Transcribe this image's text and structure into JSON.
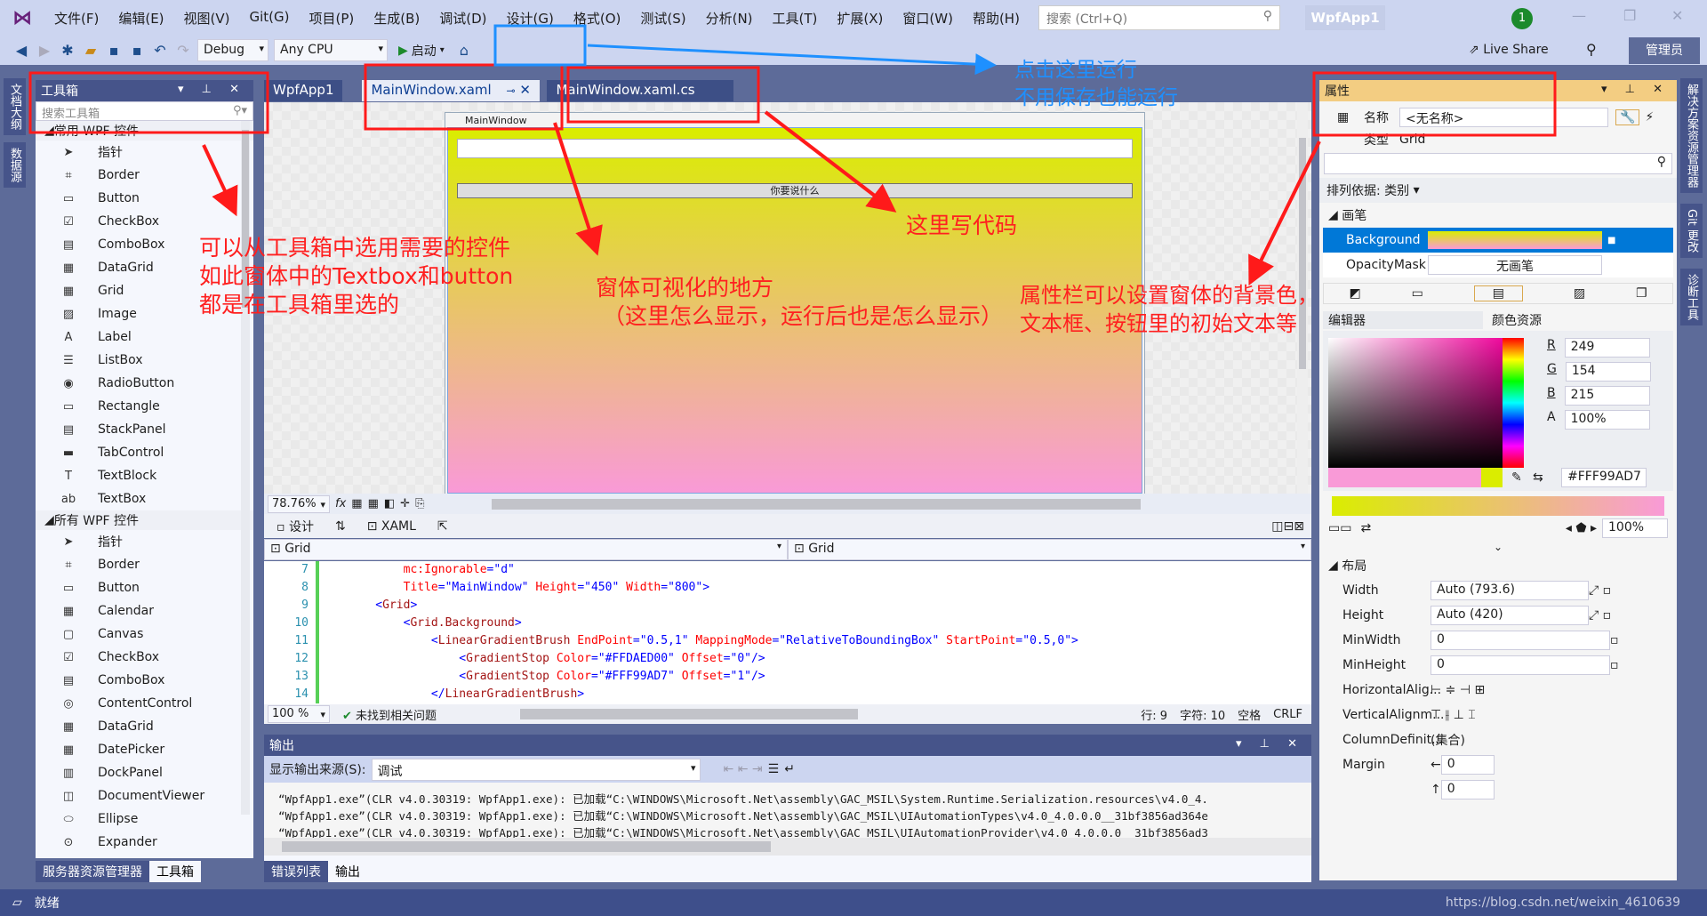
{
  "menu": [
    "文件(F)",
    "编辑(E)",
    "视图(V)",
    "Git(G)",
    "项目(P)",
    "生成(B)",
    "调试(D)",
    "设计(G)",
    "格式(O)",
    "测试(S)",
    "分析(N)",
    "工具(T)",
    "扩展(X)",
    "窗口(W)",
    "帮助(H)"
  ],
  "search_placeholder": "搜索 (Ctrl+Q)",
  "app_name": "WpfApp1",
  "notification_count": "1",
  "toolbar": {
    "config": "Debug",
    "platform": "Any CPU",
    "start": "启动",
    "live_share": "Live Share",
    "admin": "管理员"
  },
  "left_strip": [
    "文档大纲",
    "数据源"
  ],
  "right_strip": [
    "解决方案资源管理器",
    "Git 更改",
    "诊断工具"
  ],
  "toolbox": {
    "title": "工具箱",
    "search_placeholder": "搜索工具箱",
    "groups": [
      {
        "label": "常用 WPF 控件",
        "items": [
          "指针",
          "Border",
          "Button",
          "CheckBox",
          "ComboBox",
          "DataGrid",
          "Grid",
          "Image",
          "Label",
          "ListBox",
          "RadioButton",
          "Rectangle",
          "StackPanel",
          "TabControl",
          "TextBlock",
          "TextBox"
        ]
      },
      {
        "label": "所有 WPF 控件",
        "items": [
          "指针",
          "Border",
          "Button",
          "Calendar",
          "Canvas",
          "CheckBox",
          "ComboBox",
          "ContentControl",
          "DataGrid",
          "DatePicker",
          "DockPanel",
          "DocumentViewer",
          "Ellipse",
          "Expander"
        ]
      }
    ],
    "bottom_tabs": [
      "服务器资源管理器",
      "工具箱"
    ]
  },
  "doc_tabs": [
    "WpfApp1",
    "MainWindow.xaml",
    "MainWindow.xaml.cs"
  ],
  "designer": {
    "window_title": "MainWindow",
    "button_text": "你要说什么",
    "zoom": "78.76%",
    "gradient": [
      "#DAED00",
      "#F99AD7"
    ]
  },
  "view_tabs": {
    "design": "设计",
    "xaml": "XAML"
  },
  "code_combos": [
    "Grid",
    "Grid"
  ],
  "code": [
    {
      "n": "7",
      "t": [
        [
          "        ",
          ""
        ],
        [
          "mc:Ignorable",
          "a"
        ],
        [
          "=\"d\"",
          "v"
        ]
      ]
    },
    {
      "n": "8",
      "t": [
        [
          "        ",
          ""
        ],
        [
          "Title",
          "a"
        ],
        [
          "=\"MainWindow\" ",
          "v"
        ],
        [
          "Height",
          "a"
        ],
        [
          "=\"450\" ",
          "v"
        ],
        [
          "Width",
          "a"
        ],
        [
          "=\"800\">",
          "v"
        ]
      ]
    },
    {
      "n": "9",
      "t": [
        [
          "    <",
          "p"
        ],
        [
          "Grid",
          "k"
        ],
        [
          ">",
          "p"
        ]
      ]
    },
    {
      "n": "10",
      "t": [
        [
          "        <",
          "p"
        ],
        [
          "Grid.Background",
          "k"
        ],
        [
          ">",
          "p"
        ]
      ]
    },
    {
      "n": "11",
      "t": [
        [
          "            <",
          "p"
        ],
        [
          "LinearGradientBrush ",
          "k"
        ],
        [
          "EndPoint",
          "a"
        ],
        [
          "=\"0.5,1\" ",
          "v"
        ],
        [
          "MappingMode",
          "a"
        ],
        [
          "=\"RelativeToBoundingBox\" ",
          "v"
        ],
        [
          "StartPoint",
          "a"
        ],
        [
          "=\"0.5,0\">",
          "v"
        ]
      ]
    },
    {
      "n": "12",
      "t": [
        [
          "                <",
          "p"
        ],
        [
          "GradientStop ",
          "k"
        ],
        [
          "Color",
          "a"
        ],
        [
          "=\"#FFDAED00\" ",
          "v"
        ],
        [
          "Offset",
          "a"
        ],
        [
          "=\"0\"/>",
          "v"
        ]
      ]
    },
    {
      "n": "13",
      "t": [
        [
          "                <",
          "p"
        ],
        [
          "GradientStop ",
          "k"
        ],
        [
          "Color",
          "a"
        ],
        [
          "=\"#FFF99AD7\" ",
          "v"
        ],
        [
          "Offset",
          "a"
        ],
        [
          "=\"1\"/>",
          "v"
        ]
      ]
    },
    {
      "n": "14",
      "t": [
        [
          "            </",
          "p"
        ],
        [
          "LinearGradientBrush",
          "k"
        ],
        [
          ">",
          "p"
        ]
      ]
    }
  ],
  "code_status": {
    "zoom": "100 %",
    "issues": "未找到相关问题",
    "line": "行: 9",
    "char": "字符: 10",
    "spaces": "空格",
    "eol": "CRLF"
  },
  "output": {
    "title": "输出",
    "source_label": "显示输出来源(S):",
    "source": "调试",
    "lines": [
      "“WpfApp1.exe”(CLR v4.0.30319: WpfApp1.exe): 已加载“C:\\WINDOWS\\Microsoft.Net\\assembly\\GAC_MSIL\\System.Runtime.Serialization.resources\\v4.0_4.",
      "“WpfApp1.exe”(CLR v4.0.30319: WpfApp1.exe): 已加载“C:\\WINDOWS\\Microsoft.Net\\assembly\\GAC_MSIL\\UIAutomationTypes\\v4.0_4.0.0.0__31bf3856ad364e",
      "“WpfApp1.exe”(CLR v4.0.30319: WpfApp1.exe): 已加载“C:\\WINDOWS\\Microsoft.Net\\assembly\\GAC_MSIL\\UIAutomationProvider\\v4.0_4.0.0.0__31bf3856ad3"
    ],
    "tabs": [
      "错误列表",
      "输出"
    ]
  },
  "properties": {
    "title": "属性",
    "name_label": "名称",
    "name_value": "<无名称>",
    "type_label": "类型",
    "type_value": "Grid",
    "sort": "排列依据: 类别",
    "brush_group": "画笔",
    "background": "Background",
    "opacity_mask": "OpacityMask",
    "no_brush": "无画笔",
    "editor_tab": "编辑器",
    "resources_tab": "颜色资源",
    "r": "249",
    "g": "154",
    "b": "215",
    "a": "100%",
    "hex": "#FFF99AD7",
    "stop_opacity": "100%",
    "layout_group": "布局",
    "layout": [
      [
        "Width",
        "Auto (793.6)"
      ],
      [
        "Height",
        "Auto (420)"
      ],
      [
        "MinWidth",
        "0"
      ],
      [
        "MinHeight",
        "0"
      ]
    ],
    "halign": "HorizontalAlig...",
    "valign": "VerticalAlignm...",
    "coldef": "ColumnDefinit...",
    "coldef_value": "(集合)",
    "margin": "Margin",
    "margin_values": [
      "0",
      "0"
    ]
  },
  "status": "就绪",
  "watermark": "https://blog.csdn.net/weixin_4610639",
  "annotations": {
    "run": [
      "点击这里运行",
      "不用保存也能运行"
    ],
    "toolbox": [
      "可以从工具箱中选用需要的控件",
      "如此窗体中的Textbox和button",
      "都是在工具箱里选的"
    ],
    "designer": [
      "窗体可视化的地方",
      "（这里怎么显示，运行后也是怎么显示）"
    ],
    "code": "这里写代码",
    "props": [
      "属性栏可以设置窗体的背景色，",
      "文本框、按钮里的初始文本等"
    ]
  }
}
